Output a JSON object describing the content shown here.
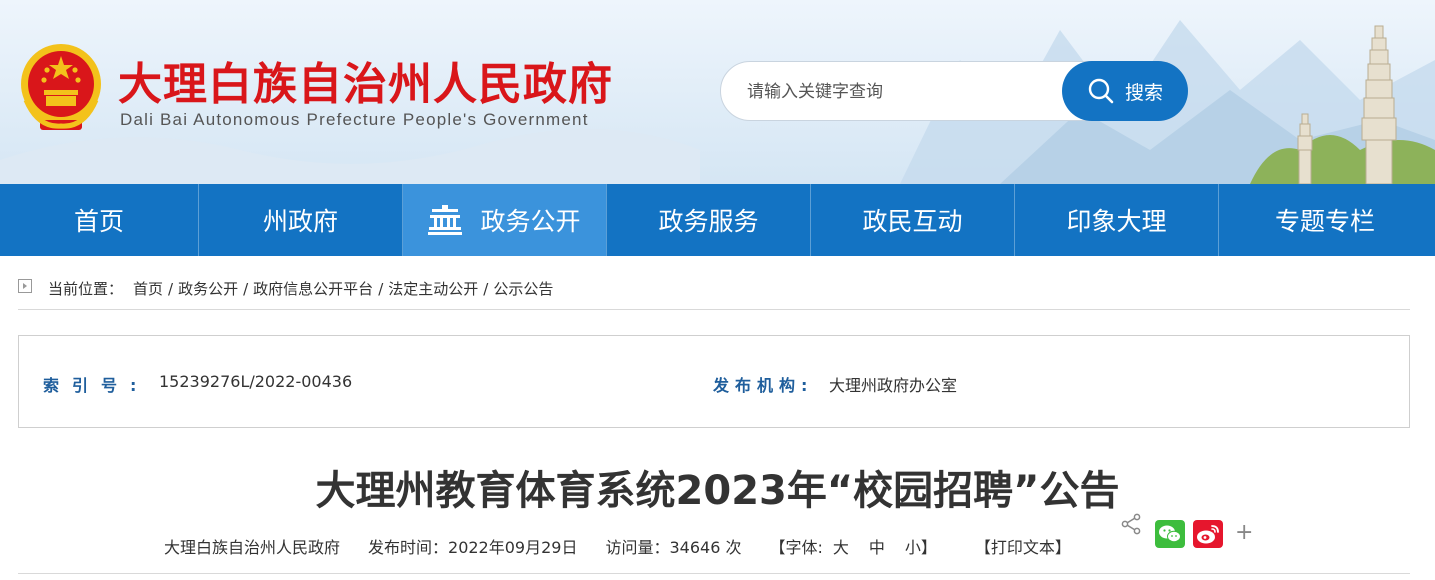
{
  "header": {
    "title": "大理白族自治州人民政府",
    "subtitle": "Dali Bai Autonomous Prefecture People's Government",
    "emblem_icon": "national-emblem-icon",
    "search": {
      "placeholder": "请输入关键字查询",
      "button_label": "搜索",
      "button_icon": "search-icon"
    }
  },
  "nav": {
    "items": [
      {
        "label": "首页"
      },
      {
        "label": "州政府"
      },
      {
        "label": "政务公开",
        "active": true,
        "icon": "temple-icon"
      },
      {
        "label": "政务服务"
      },
      {
        "label": "政民互动"
      },
      {
        "label": "印象大理"
      },
      {
        "label": "专题专栏"
      }
    ]
  },
  "breadcrumb": {
    "label": "当前位置：",
    "items": [
      "首页",
      "政务公开",
      "政府信息公开平台",
      "法定主动公开",
      "公示公告"
    ],
    "separator": "/"
  },
  "meta": {
    "index_key": "索引号:",
    "index_value": "15239276L/2022-00436",
    "org_key": "发布机构:",
    "org_value": "大理州政府办公室"
  },
  "article": {
    "title": "大理州教育体育系统2023年“校园招聘”公告",
    "source": "大理白族自治州人民政府",
    "publish_time": "发布时间：2022年09月29日",
    "views": "访问量：34646 次",
    "font_label_open": "【字体:",
    "font_large": "大",
    "font_medium": "中",
    "font_small": "小】",
    "print_label": "【打印文本】"
  },
  "share": {
    "share_icon": "share-icon",
    "wechat_icon": "wechat-icon",
    "weibo_icon": "weibo-icon",
    "more_label": "+"
  },
  "colors": {
    "title_red": "#d9161a",
    "nav_blue": "#1373c3",
    "nav_active": "#3b93dc",
    "meta_key_blue": "#1f5e9c",
    "wechat_green": "#3dbd3d",
    "weibo_red": "#e6162d"
  }
}
